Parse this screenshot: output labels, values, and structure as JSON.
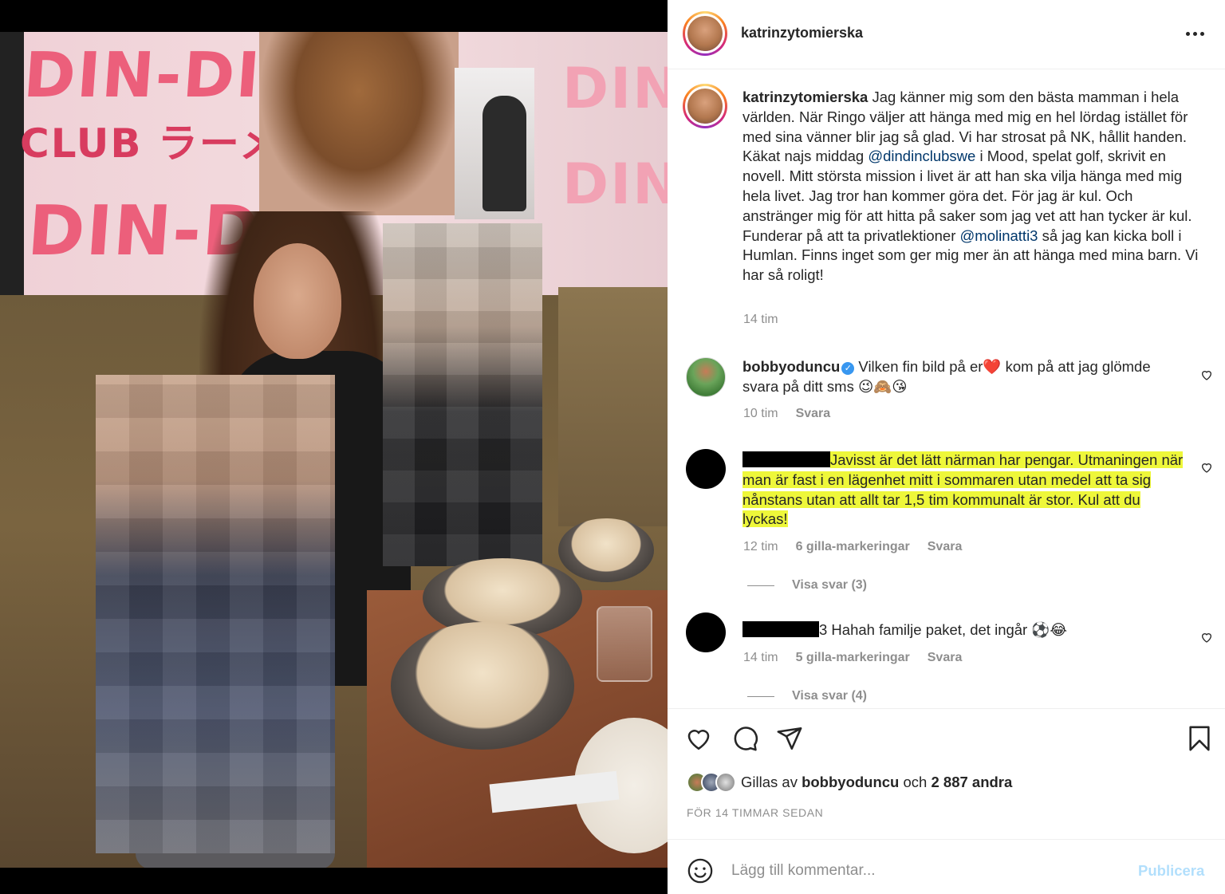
{
  "post": {
    "username": "katrinzytomierska",
    "poster_texts": [
      "DIN-DIN",
      "CLUB ラーメンスープ",
      "DIN-DIN",
      "DIN-",
      "DIN-"
    ]
  },
  "caption": {
    "username": "katrinzytomierska",
    "text_1": " Jag känner mig som den bästa mamman i hela världen. När Ringo väljer att hänga med mig en hel lördag istället för med sina vänner blir jag så glad. Vi har strosat på NK, hållit handen. Käkat najs middag ",
    "mention_1": "@dindinclubswe",
    "text_2": " i Mood, spelat golf, skrivit en novell. Mitt största mission i livet är att han ska vilja hänga med mig hela livet. Jag tror han kommer göra det. För jag är kul. Och anstränger mig för att hitta på saker som jag vet att han tycker är kul. Funderar på att ta privatlektioner ",
    "mention_2": "@molinatti3",
    "text_3": " så jag kan kicka boll i Humlan. Finns inget som ger mig mer än att hänga med mina barn. Vi har så roligt!",
    "time": "14 tim"
  },
  "comments": [
    {
      "username": "bobbyoduncu",
      "text": " Vilken fin bild på er❤️ kom på att jag glömde svara på ditt sms 😉🙈😘",
      "time": "10 tim",
      "reply": "Svara"
    },
    {
      "username_visible": "",
      "text": "Javisst är det lätt närman har pengar. Utmaningen när man är fast i en lägenhet mitt i sommaren utan medel att ta sig nånstans utan att allt tar 1,5 tim kommunalt är stor. Kul att du lyckas!",
      "time": "12 tim",
      "likes": "6 gilla-markeringar",
      "reply": "Svara",
      "view_replies": "Visa svar (3)"
    },
    {
      "username_visible": "3",
      "text": " Hahah familje paket, det ingår ⚽😂",
      "time": "14 tim",
      "likes": "5 gilla-markeringar",
      "reply": "Svara",
      "view_replies": "Visa svar (4)"
    }
  ],
  "likes": {
    "prefix": "Gillas av ",
    "user": "bobbyoduncu",
    "middle": " och ",
    "others": "2 887 andra"
  },
  "timestamp": "FÖR 14 TIMMAR SEDAN",
  "add_comment": {
    "placeholder": "Lägg till kommentar...",
    "publish_label": "Publicera"
  },
  "colors": {
    "highlight": "#eef73a",
    "mention": "#00376b",
    "publish_disabled": "#b2dffc",
    "muted": "#8e8e8e"
  },
  "icons": [
    "more-icon",
    "heart-icon",
    "comment-icon",
    "share-icon",
    "bookmark-icon",
    "emoji-icon",
    "small-heart-icon",
    "verified-icon"
  ]
}
